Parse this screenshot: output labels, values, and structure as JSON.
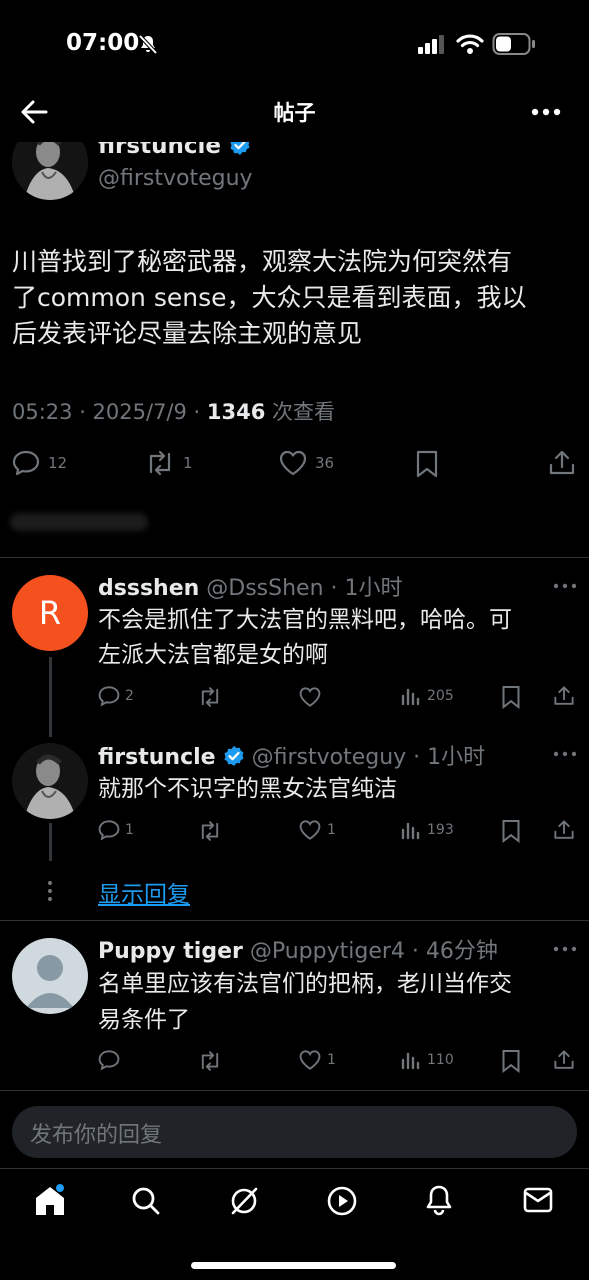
{
  "status": {
    "time": "07:00"
  },
  "nav": {
    "title": "帖子"
  },
  "main_post": {
    "name": "firstuncle",
    "handle": "@firstvoteguy",
    "text_lines": [
      "川普找到了秘密武器，观察大法院为何突然有",
      "了common sense，大众只是看到表面，我以",
      "后发表评论尽量去除主观的意见"
    ],
    "time": "05:23 · 2025/7/9 · ",
    "views": "1346",
    "views_label": " 次查看",
    "replies": "12",
    "reposts": "1",
    "likes": "36"
  },
  "reply1": {
    "avatar_letter": "R",
    "name": "dssshen",
    "meta": "@DssShen · 1小时",
    "text_lines": [
      "不会是抓住了大法官的黑料吧，哈哈。可",
      "左派大法官都是女的啊"
    ],
    "replies": "2",
    "likes": "",
    "views": "205"
  },
  "reply2": {
    "name": "firstuncle",
    "meta": "@firstvoteguy · 1小时",
    "text_lines": [
      "就那个不识字的黑女法官纯洁"
    ],
    "replies": "1",
    "likes": "1",
    "views": "193"
  },
  "show_replies": "显示回复",
  "reply3": {
    "name": "Puppy tiger",
    "meta": "@Puppytiger4 · 46分钟",
    "text_lines": [
      "名单里应该有法官们的把柄，老川当作交",
      "易条件了"
    ],
    "replies": "",
    "likes": "1",
    "views": "110"
  },
  "reply_input": {
    "placeholder": "发布你的回复"
  },
  "colors": {
    "accent": "#1d9bf0",
    "avatar_r": "#f4511e",
    "background": "#000000",
    "muted": "#71767b"
  }
}
